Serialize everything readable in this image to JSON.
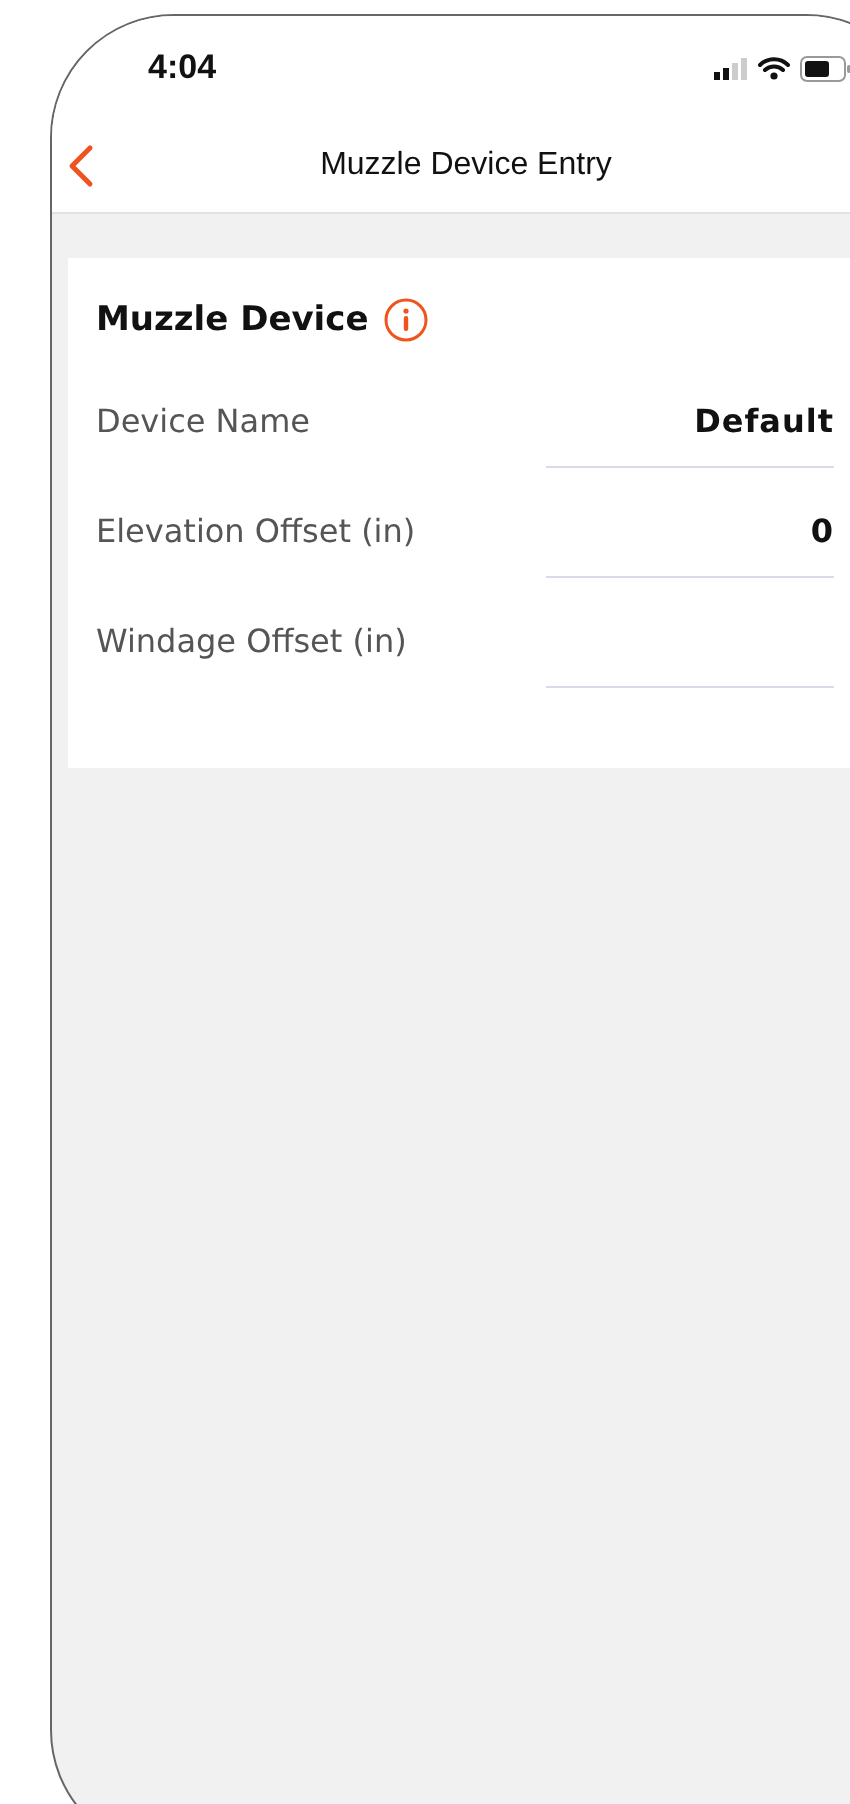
{
  "status_bar": {
    "time": "4:04"
  },
  "nav_bar": {
    "title": "Muzzle Device Entry"
  },
  "card": {
    "title": "Muzzle Device",
    "fields": [
      {
        "label": "Device Name",
        "value": "Default"
      },
      {
        "label": "Elevation Offset (in)",
        "value": "0"
      },
      {
        "label": "Windage Offset (in)"
      }
    ]
  }
}
